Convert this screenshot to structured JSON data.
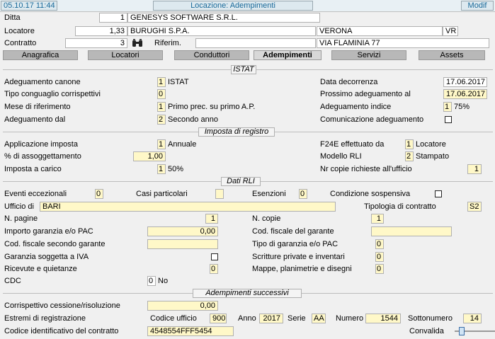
{
  "titlebar": {
    "datetime": "05.10.17 11:44",
    "title": "Locazione: Adempimenti",
    "mode": "Modif"
  },
  "header": {
    "ditta_label": "Ditta",
    "ditta_code": "1",
    "ditta_name": "GENESYS SOFTWARE S.R.L.",
    "locatore_label": "Locatore",
    "locatore_code": "1,33",
    "locatore_name": "BURUGHI S.P.A.",
    "locatore_city": "VERONA",
    "locatore_prov": "VR",
    "contratto_label": "Contratto",
    "contratto_code": "3",
    "riferim_label": "Riferim.",
    "riferim_value": "",
    "address": "VIA FLAMINIA 77"
  },
  "tabs": [
    {
      "label": "Anagrafica"
    },
    {
      "label": "Locatori"
    },
    {
      "label": "Conduttori"
    },
    {
      "label": "Adempimenti"
    },
    {
      "label": "Servizi"
    },
    {
      "label": "Assets"
    }
  ],
  "istat": {
    "title": "ISTAT",
    "adeguamento_canone_label": "Adeguamento canone",
    "adeguamento_canone_code": "1",
    "adeguamento_canone_desc": "ISTAT",
    "tipo_conguaglio_label": "Tipo conguaglio corrispettivi",
    "tipo_conguaglio_code": "0",
    "mese_rif_label": "Mese di riferimento",
    "mese_rif_code": "1",
    "mese_rif_desc": "Primo prec. su primo A.P.",
    "adeguamento_dal_label": "Adeguamento dal",
    "adeguamento_dal_code": "2",
    "adeguamento_dal_desc": "Secondo anno",
    "data_decorrenza_label": "Data decorrenza",
    "data_decorrenza": "17.06.2017",
    "prossimo_adeg_label": "Prossimo adeguamento al",
    "prossimo_adeg": "17.06.2017",
    "adeg_indice_label": "Adeguamento indice",
    "adeg_indice_code": "1",
    "adeg_indice_desc": "75%",
    "comunicazione_label": "Comunicazione adeguamento"
  },
  "registro": {
    "title": "Imposta di registro",
    "applicazione_label": "Applicazione imposta",
    "applicazione_code": "1",
    "applicazione_desc": "Annuale",
    "assoggettamento_label": "% di assoggettamento",
    "assoggettamento_value": "1,00",
    "carico_label": "Imposta a carico",
    "carico_code": "1",
    "carico_desc": "50%",
    "f24e_label": "F24E effettuato da",
    "f24e_code": "1",
    "f24e_desc": "Locatore",
    "modello_label": "Modello RLI",
    "modello_code": "2",
    "modello_desc": "Stampato",
    "copie_label": "Nr copie richieste all'ufficio",
    "copie_value": "1"
  },
  "rli": {
    "title": "Dati RLI",
    "eventi_label": "Eventi eccezionali",
    "eventi_value": "0",
    "casi_label": "Casi particolari",
    "casi_value": "",
    "esenzioni_label": "Esenzioni",
    "esenzioni_value": "0",
    "condizione_label": "Condizione sospensiva",
    "ufficio_label": "Ufficio di",
    "ufficio_value": "BARI",
    "tipologia_label": "Tipologia di contratto",
    "tipologia_value": "S2",
    "pagine_label": "N. pagine",
    "pagine_value": "1",
    "ncopie_label": "N. copie",
    "ncopie_value": "1",
    "garanzia_label": "Importo garanzia e/o PAC",
    "garanzia_value": "0,00",
    "cf_garante_label": "Cod. fiscale del garante",
    "cf_garante_value": "",
    "cf_secondo_label": "Cod. fiscale secondo garante",
    "cf_secondo_value": "",
    "tipo_garanzia_label": "Tipo di garanzia e/o PAC",
    "tipo_garanzia_value": "0",
    "garanzia_iva_label": "Garanzia soggetta a IVA",
    "scritture_label": "Scritture private e inventari",
    "scritture_value": "0",
    "ricevute_label": "Ricevute e quietanze",
    "ricevute_value": "0",
    "mappe_label": "Mappe, planimetrie e disegni",
    "mappe_value": "0",
    "cdc_label": "CDC",
    "cdc_code": "0",
    "cdc_desc": "No"
  },
  "successivi": {
    "title": "Adempimenti successivi",
    "cessione_label": "Corrispettivo cessione/risoluzione",
    "cessione_value": "0,00",
    "estremi_label": "Estremi di registrazione",
    "codice_ufficio_label": "Codice ufficio",
    "codice_ufficio_value": "900",
    "anno_label": "Anno",
    "anno_value": "2017",
    "serie_label": "Serie",
    "serie_value": "AA",
    "numero_label": "Numero",
    "numero_value": "1544",
    "sottonumero_label": "Sottonumero",
    "sottonumero_value": "14",
    "codice_contratto_label": "Codice identificativo del contratto",
    "codice_contratto_value": "4548554FFF5454",
    "convalida_label": "Convalida"
  },
  "colors": {
    "field_highlight": "#fff8c8",
    "tab_bg": "#b8b8b8",
    "title_text": "#1a6a9a"
  }
}
